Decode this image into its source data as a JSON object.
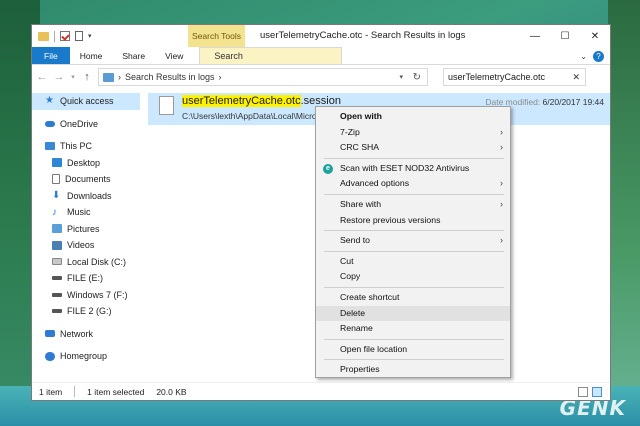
{
  "window": {
    "title": "userTelemetryCache.otc - Search Results in logs",
    "context_tab": "Search Tools"
  },
  "title_buttons": {
    "minimize": "—",
    "maximize": "☐",
    "close": "✕"
  },
  "ribbon": {
    "tabs": [
      "File",
      "Home",
      "Share",
      "View",
      "Search"
    ],
    "help": "?"
  },
  "address": {
    "breadcrumb": "Search Results in logs",
    "search_value": "userTelemetryCache.otc"
  },
  "nav_pane": {
    "items": [
      {
        "label": "Quick access",
        "icon": "star-icon"
      },
      {
        "label": "OneDrive",
        "icon": "cloud-icon"
      },
      {
        "label": "This PC",
        "icon": "monitor-icon"
      },
      {
        "label": "Desktop",
        "icon": "desktop-icon"
      },
      {
        "label": "Documents",
        "icon": "documents-icon"
      },
      {
        "label": "Downloads",
        "icon": "download-icon"
      },
      {
        "label": "Music",
        "icon": "music-icon"
      },
      {
        "label": "Pictures",
        "icon": "pictures-icon"
      },
      {
        "label": "Videos",
        "icon": "videos-icon"
      },
      {
        "label": "Local Disk (C:)",
        "icon": "disk-icon"
      },
      {
        "label": "FILE (E:)",
        "icon": "drive-icon"
      },
      {
        "label": "Windows 7 (F:)",
        "icon": "drive-icon"
      },
      {
        "label": "FILE 2 (G:)",
        "icon": "drive-icon"
      },
      {
        "label": "Network",
        "icon": "network-icon"
      },
      {
        "label": "Homegroup",
        "icon": "homegroup-icon"
      }
    ]
  },
  "result": {
    "name_highlight": "userTelemetryCache.otc",
    "name_rest": ".session",
    "path": "C:\\Users\\lexth\\AppData\\Local\\Micro",
    "date_label": "Date modified:",
    "date_value": "6/20/2017 19:44"
  },
  "status": {
    "count": "1 item",
    "selection": "1 item selected",
    "size": "20.0 KB"
  },
  "context_menu": {
    "groups": [
      [
        {
          "label": "Open with",
          "bold": true
        },
        {
          "label": "7-Zip",
          "submenu": true
        },
        {
          "label": "CRC SHA",
          "submenu": true
        }
      ],
      [
        {
          "label": "Scan with ESET NOD32 Antivirus",
          "icon": "eset-icon"
        },
        {
          "label": "Advanced options",
          "submenu": true
        }
      ],
      [
        {
          "label": "Share with",
          "submenu": true
        },
        {
          "label": "Restore previous versions"
        }
      ],
      [
        {
          "label": "Send to",
          "submenu": true
        }
      ],
      [
        {
          "label": "Cut"
        },
        {
          "label": "Copy"
        }
      ],
      [
        {
          "label": "Create shortcut"
        },
        {
          "label": "Delete",
          "hover": true
        },
        {
          "label": "Rename"
        }
      ],
      [
        {
          "label": "Open file location"
        }
      ],
      [
        {
          "label": "Properties"
        }
      ]
    ]
  },
  "watermark": "GENK"
}
